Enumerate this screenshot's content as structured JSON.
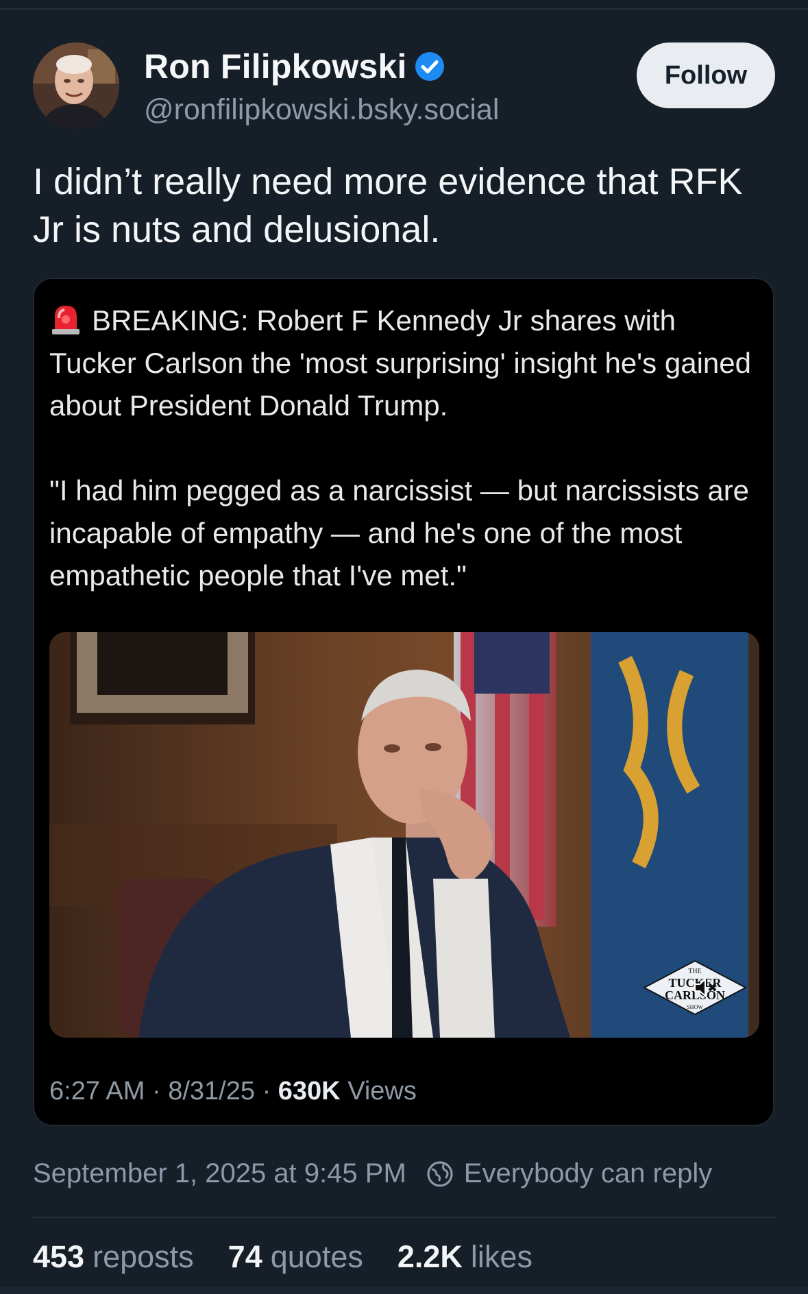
{
  "author": {
    "display_name": "Ron Filipkowski",
    "handle": "@ronfilipkowski.bsky.social",
    "verified": true,
    "avatar_icon": "avatar-photo"
  },
  "follow_label": "Follow",
  "post_text": "I didn’t really need more evidence that RFK Jr is nuts and delusional.",
  "embed": {
    "icon": "siren-icon",
    "paragraph1": "BREAKING: Robert F Kennedy Jr shares with Tucker Carlson the 'most surprising' insight he's gained about President Donald Trump.",
    "paragraph2": "\"I had him pegged as a narcissist — but narcissists are incapable of empathy — and he's one of the most empathetic people that I've met.\"",
    "media_logo": "THE TUCKER CARLSON SHOW",
    "time": "6:27 AM",
    "date": "8/31/25",
    "views_count": "630K",
    "views_label": "Views"
  },
  "footer": {
    "timestamp": "September 1, 2025 at 9:45 PM",
    "reply_setting": "Everybody can reply"
  },
  "stats": {
    "reposts_count": "453",
    "reposts_label": "reposts",
    "quotes_count": "74",
    "quotes_label": "quotes",
    "likes_count": "2.2K",
    "likes_label": "likes"
  },
  "colors": {
    "background": "#161e27",
    "verified_blue": "#1d8bf2",
    "muted_text": "#8b99a8"
  }
}
